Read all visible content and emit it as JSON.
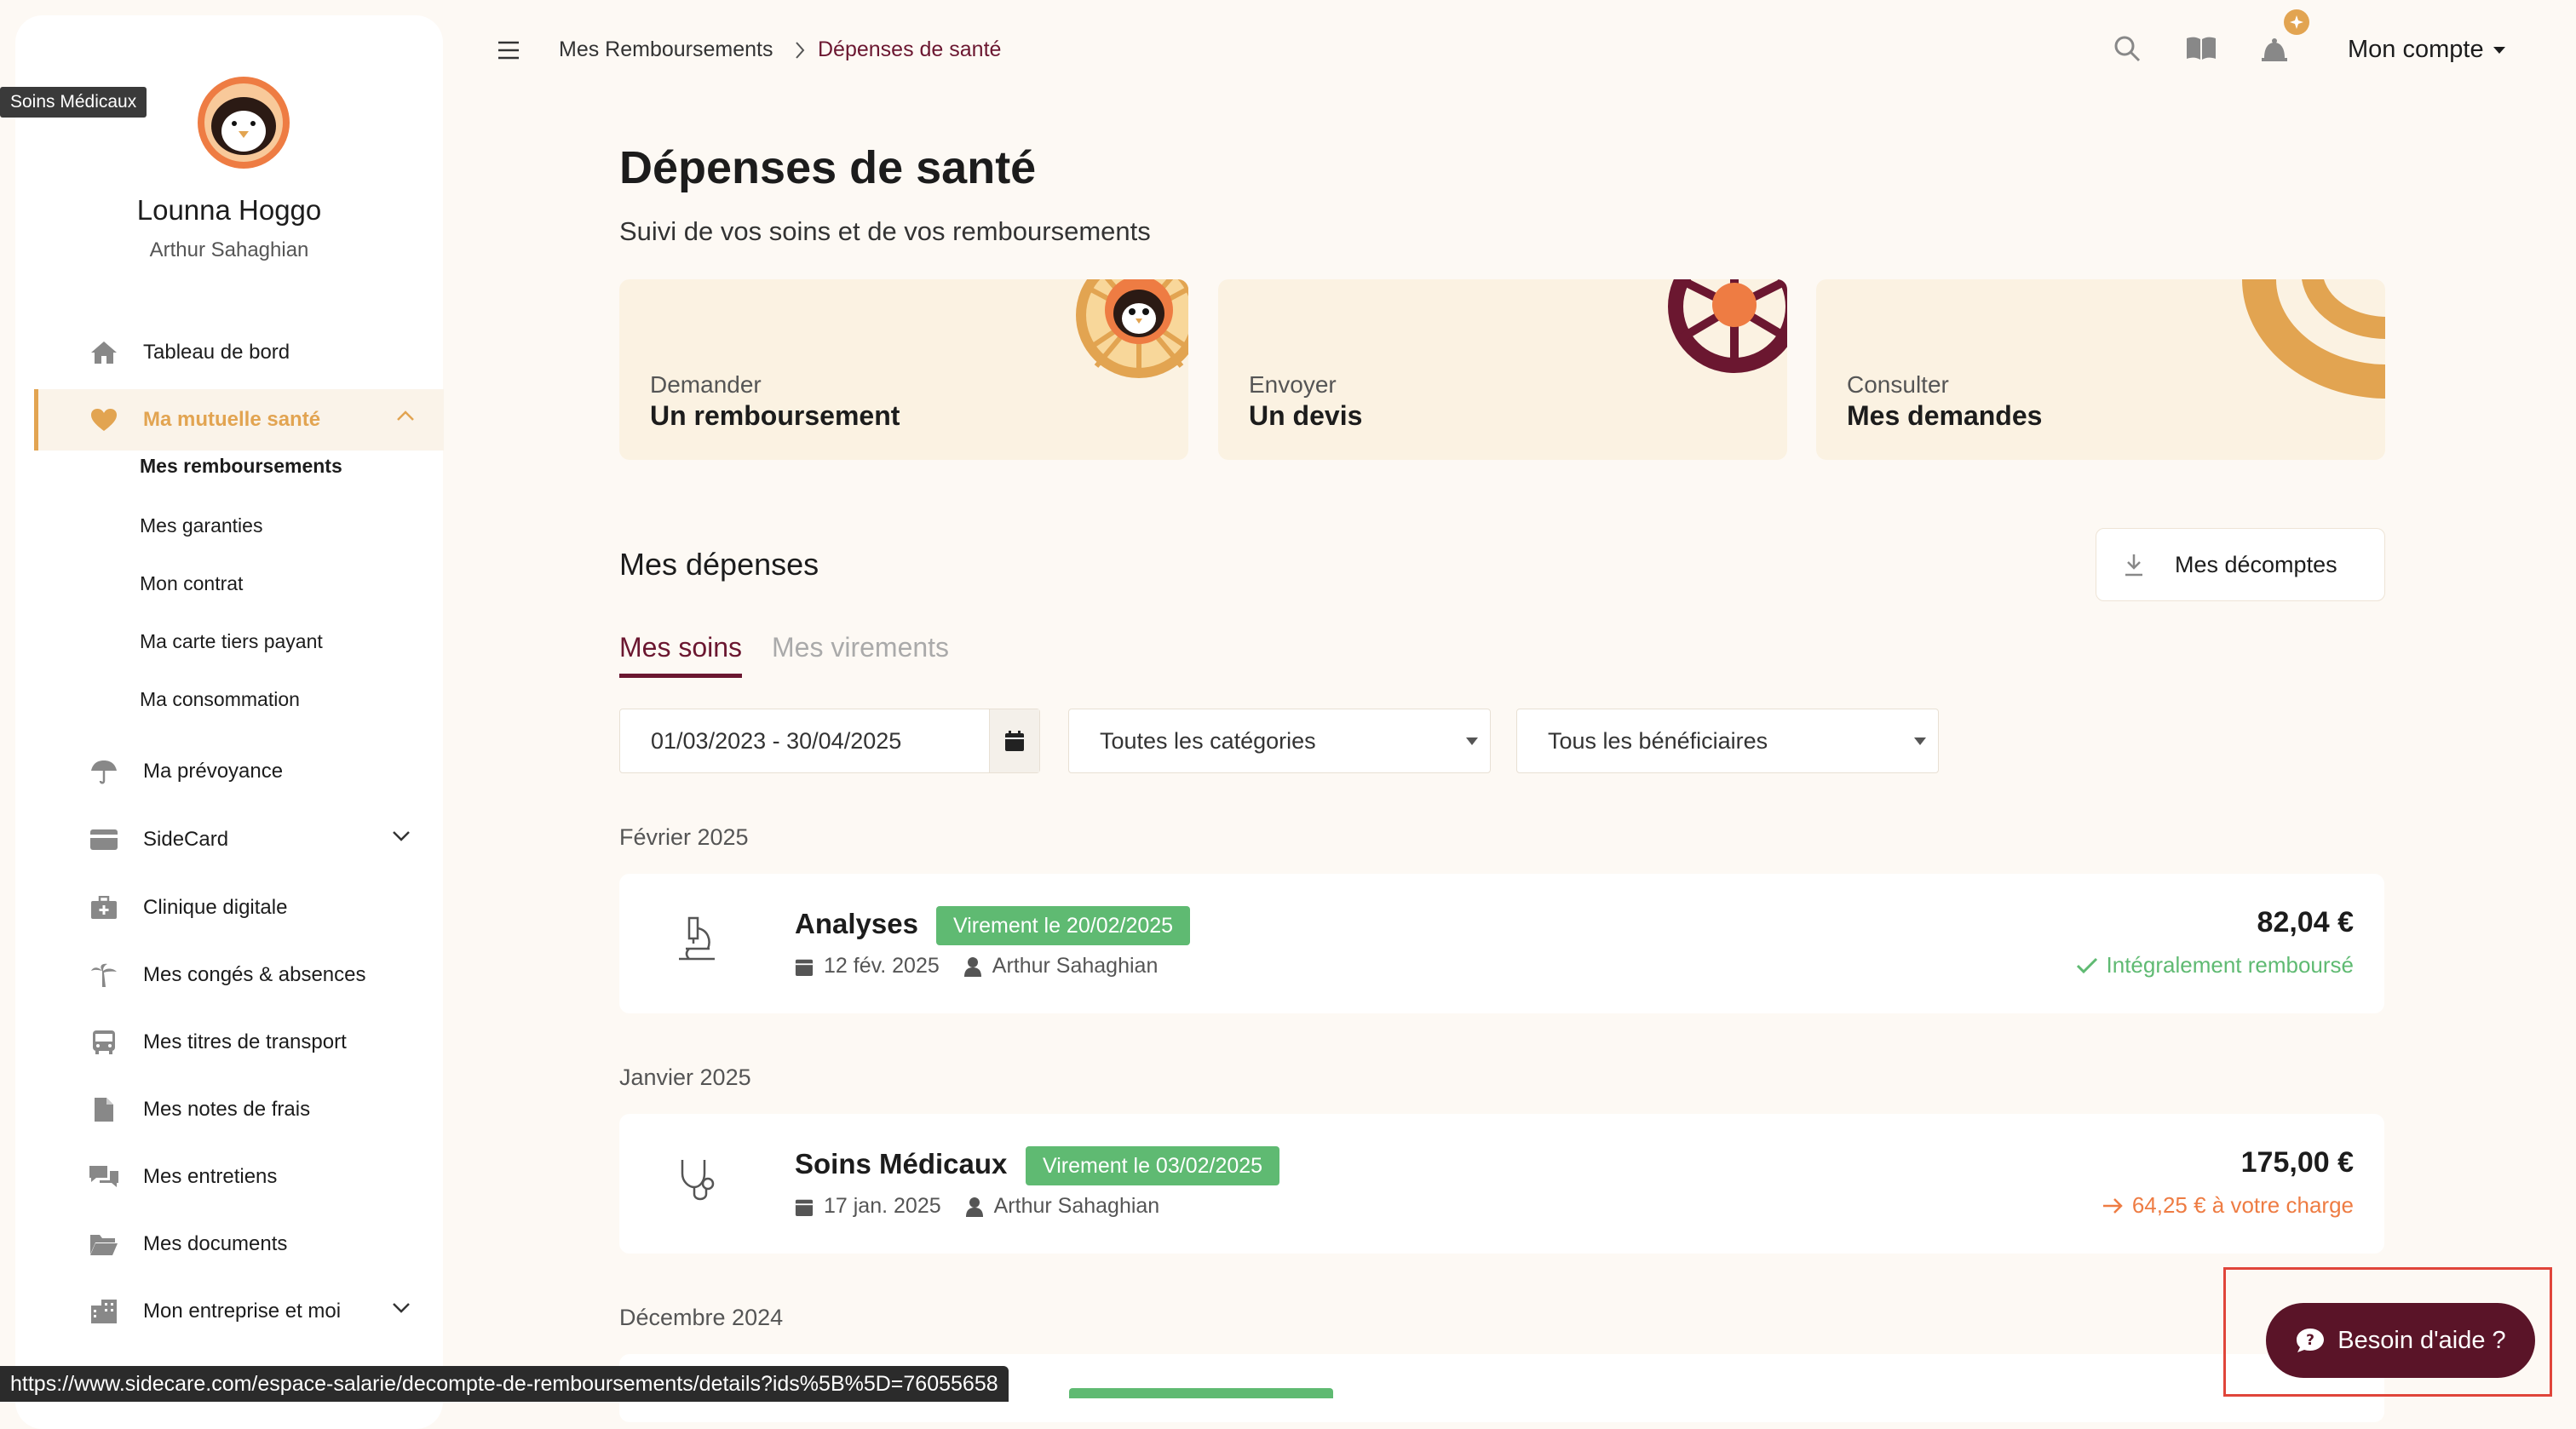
{
  "sidebar": {
    "tooltip": "Soins Médicaux",
    "user_name": "Lounna Hoggo",
    "user_sub": "Arthur Sahaghian",
    "items": [
      {
        "label": "Tableau de bord",
        "icon": "home-icon"
      },
      {
        "label": "Ma mutuelle santé",
        "icon": "heart-icon",
        "active": true
      },
      {
        "label": "Ma prévoyance",
        "icon": "umbrella-icon"
      },
      {
        "label": "SideCard",
        "icon": "card-icon"
      },
      {
        "label": "Clinique digitale",
        "icon": "medical-kit-icon"
      },
      {
        "label": "Mes congés & absences",
        "icon": "palm-tree-icon"
      },
      {
        "label": "Mes titres de transport",
        "icon": "bus-icon"
      },
      {
        "label": "Mes notes de frais",
        "icon": "file-icon"
      },
      {
        "label": "Mes entretiens",
        "icon": "chat-icon"
      },
      {
        "label": "Mes documents",
        "icon": "folder-icon"
      },
      {
        "label": "Mon entreprise et moi",
        "icon": "building-icon"
      }
    ],
    "subitems": [
      {
        "label": "Mes remboursements",
        "current": true
      },
      {
        "label": "Mes garanties"
      },
      {
        "label": "Mon contrat"
      },
      {
        "label": "Ma carte tiers payant"
      },
      {
        "label": "Ma consommation"
      }
    ]
  },
  "header": {
    "breadcrumb_parent": "Mes Remboursements",
    "breadcrumb_current": "Dépenses de santé",
    "account_label": "Mon compte"
  },
  "page": {
    "title": "Dépenses de santé",
    "subtitle": "Suivi de vos soins et de vos remboursements"
  },
  "actions": [
    {
      "kicker": "Demander",
      "label": "Un remboursement"
    },
    {
      "kicker": "Envoyer",
      "label": "Un devis"
    },
    {
      "kicker": "Consulter",
      "label": "Mes demandes"
    }
  ],
  "expenses": {
    "title": "Mes dépenses",
    "download_label": "Mes décomptes",
    "tabs": [
      "Mes soins",
      "Mes virements"
    ],
    "date_range": "01/03/2023 - 30/04/2025",
    "category_select": "Toutes les catégories",
    "beneficiary_select": "Tous les bénéficiaires",
    "groups": [
      {
        "month": "Février 2025",
        "title": "Analyses",
        "badge": "Virement le 20/02/2025",
        "date": "12 fév. 2025",
        "person": "Arthur Sahaghian",
        "amount": "82,04 €",
        "status": "Intégralement remboursé",
        "icon": "microscope-icon"
      },
      {
        "month": "Janvier 2025",
        "title": "Soins Médicaux",
        "badge": "Virement le 03/02/2025",
        "date": "17 jan. 2025",
        "person": "Arthur Sahaghian",
        "amount": "175,00 €",
        "status": "64,25 € à votre charge",
        "icon": "stethoscope-icon"
      }
    ],
    "next_month": "Décembre 2024"
  },
  "status_url": "https://www.sidecare.com/espace-salarie/decompte-de-remboursements/details?ids%5B%5D=76055658",
  "help_label": "Besoin d'aide ?",
  "colors": {
    "accent_gold": "#e2a451",
    "brand_burgundy": "#6b1730",
    "success_green": "#5fba72",
    "warning_orange": "#ee7c43"
  }
}
